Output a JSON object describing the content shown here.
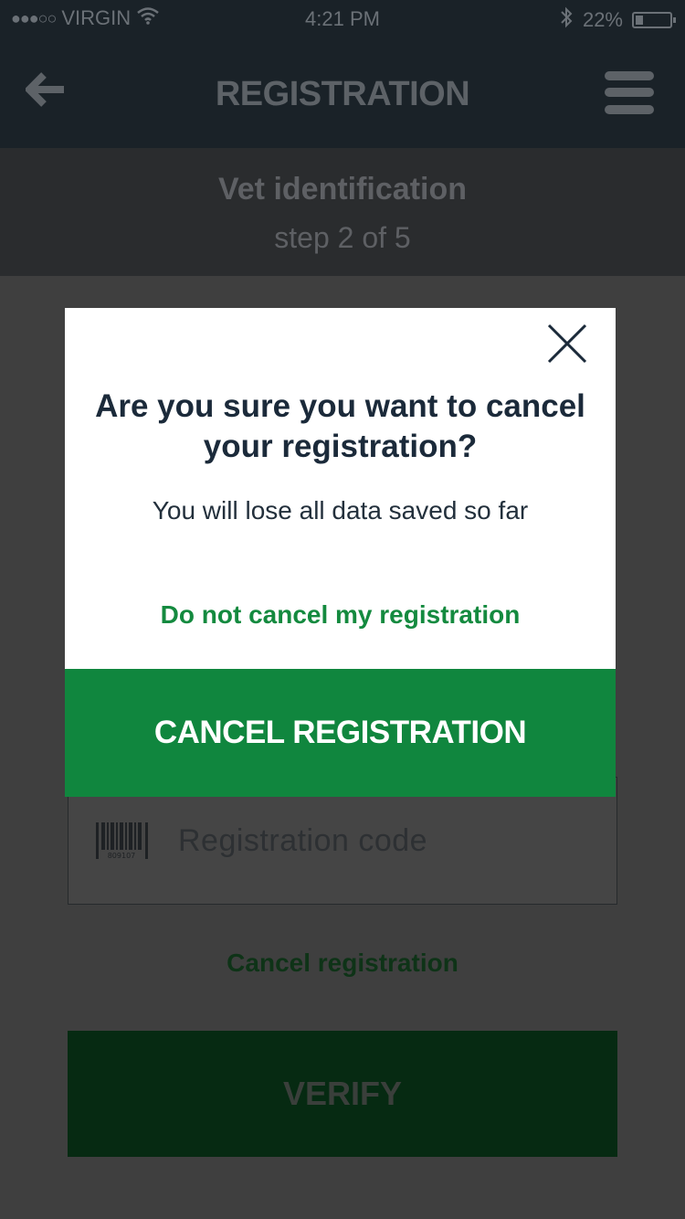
{
  "status_bar": {
    "signal_dots": "●●●○○",
    "carrier": "VIRGIN",
    "wifi_icon": "wifi-icon",
    "time": "4:21 PM",
    "bluetooth_icon": "bluetooth-icon",
    "battery_percent": "22%",
    "battery_level": 0.22
  },
  "nav": {
    "back_icon": "arrow-left-icon",
    "title": "REGISTRATION",
    "menu_icon": "hamburger-menu-icon"
  },
  "step": {
    "title": "Vet identification",
    "subtitle": "step 2 of 5"
  },
  "form": {
    "registration_code_placeholder": "Registration code",
    "barcode_icon": "barcode-icon",
    "barcode_digits": "809107",
    "cancel_link": "Cancel registration",
    "verify_label": "VERIFY"
  },
  "modal": {
    "close_icon": "close-icon",
    "title": "Are you sure you want to cancel your registration?",
    "body": "You will lose all data saved so far",
    "keep_link": "Do not cancel my registration",
    "confirm_label": "CANCEL REGISTRATION"
  },
  "colors": {
    "accent_green": "#10863e",
    "link_green": "#148a3f",
    "dark_header": "#1a2228",
    "overlay_gray": "#3f3f3f"
  }
}
